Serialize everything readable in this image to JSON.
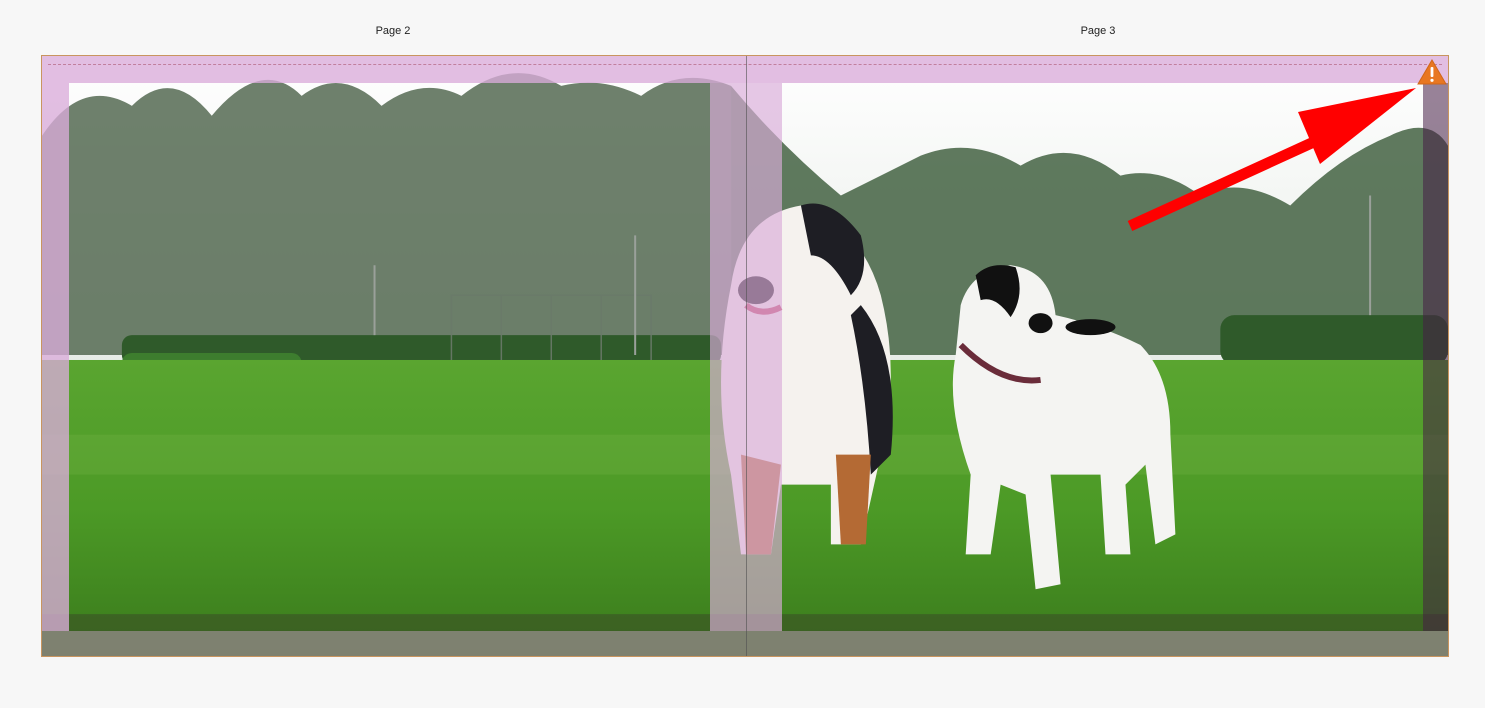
{
  "pages": {
    "left_label": "Page 2",
    "right_label": "Page 3"
  },
  "colors": {
    "bleed_overlay": "#daacda",
    "spread_border": "#c9955f",
    "warning": "#e87722",
    "arrow": "#ff0000",
    "grass": "#4f9a2a",
    "sky": "#f4f6f4",
    "trees": "#3e5a3e"
  },
  "icons": {
    "warning": "warning-triangle-icon",
    "annotation": "red-arrow-annotation"
  },
  "photo": {
    "subject": "two-dogs-in-park"
  }
}
